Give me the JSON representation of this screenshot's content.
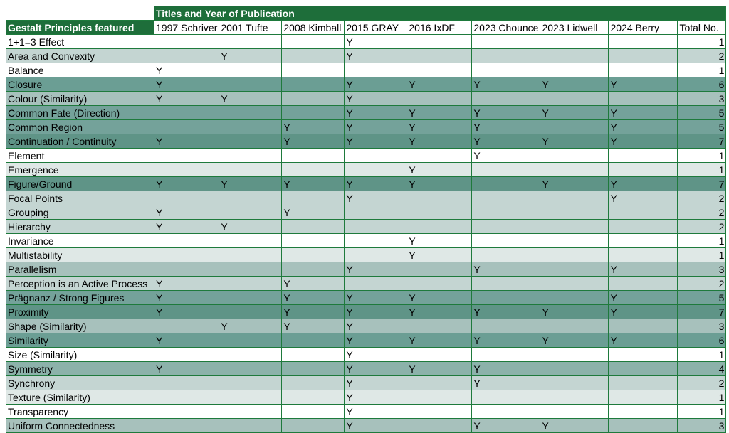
{
  "sheet": {
    "title": "Titles and Year of Publication",
    "row_header_label": "Gestalt Principles featured",
    "columns": [
      "1997 Schriver",
      "2001 Tufte",
      "2008 Kimball",
      "2015 GRAY",
      "2016 IxDF",
      "2023 Chounce",
      "2023 Lidwell",
      "2024 Berry"
    ],
    "total_label": "Total No.",
    "rows": [
      {
        "name": "1+1=3 Effect",
        "marks": [
          "",
          "",
          "",
          "Y",
          "",
          "",
          "",
          ""
        ],
        "total": "1"
      },
      {
        "name": "Area and Convexity",
        "marks": [
          "",
          "Y",
          "",
          "Y",
          "",
          "",
          "",
          ""
        ],
        "total": "2"
      },
      {
        "name": "Balance",
        "marks": [
          "Y",
          "",
          "",
          "",
          "",
          "",
          "",
          ""
        ],
        "total": "1"
      },
      {
        "name": "Closure",
        "marks": [
          "Y",
          "",
          "",
          "Y",
          "Y",
          "Y",
          "Y",
          "Y"
        ],
        "total": "6"
      },
      {
        "name": "Colour (Similarity)",
        "marks": [
          "Y",
          "Y",
          "",
          "Y",
          "",
          "",
          "",
          ""
        ],
        "total": "3"
      },
      {
        "name": "Common Fate (Direction)",
        "marks": [
          "",
          "",
          "",
          "Y",
          "Y",
          "Y",
          "Y",
          "Y"
        ],
        "total": "5"
      },
      {
        "name": "Common Region",
        "marks": [
          "",
          "",
          "Y",
          "Y",
          "Y",
          "Y",
          "",
          "Y"
        ],
        "total": "5"
      },
      {
        "name": "Continuation / Continuity",
        "marks": [
          "Y",
          "",
          "Y",
          "Y",
          "Y",
          "Y",
          "Y",
          "Y"
        ],
        "total": "7"
      },
      {
        "name": "Element",
        "marks": [
          "",
          "",
          "",
          "",
          "",
          "Y",
          "",
          ""
        ],
        "total": "1"
      },
      {
        "name": "Emergence",
        "marks": [
          "",
          "",
          "",
          "",
          "Y",
          "",
          "",
          ""
        ],
        "total": "1"
      },
      {
        "name": "Figure/Ground",
        "marks": [
          "Y",
          "Y",
          "Y",
          "Y",
          "Y",
          "",
          "Y",
          "Y"
        ],
        "total": "7"
      },
      {
        "name": "Focal Points",
        "marks": [
          "",
          "",
          "",
          "Y",
          "",
          "",
          "",
          "Y"
        ],
        "total": "2"
      },
      {
        "name": "Grouping",
        "marks": [
          "Y",
          "",
          "Y",
          "",
          "",
          "",
          "",
          ""
        ],
        "total": "2"
      },
      {
        "name": "Hierarchy",
        "marks": [
          "Y",
          "Y",
          "",
          "",
          "",
          "",
          "",
          ""
        ],
        "total": "2"
      },
      {
        "name": "Invariance",
        "marks": [
          "",
          "",
          "",
          "",
          "Y",
          "",
          "",
          ""
        ],
        "total": "1"
      },
      {
        "name": "Multistability",
        "marks": [
          "",
          "",
          "",
          "",
          "Y",
          "",
          "",
          ""
        ],
        "total": "1"
      },
      {
        "name": "Parallelism",
        "marks": [
          "",
          "",
          "",
          "Y",
          "",
          "Y",
          "",
          "Y"
        ],
        "total": "3"
      },
      {
        "name": "Perception is an Active Process",
        "marks": [
          "Y",
          "",
          "Y",
          "",
          "",
          "",
          "",
          ""
        ],
        "total": "2"
      },
      {
        "name": "Prägnanz / Strong Figures",
        "marks": [
          "Y",
          "",
          "Y",
          "Y",
          "Y",
          "",
          "",
          "Y"
        ],
        "total": "5"
      },
      {
        "name": "Proximity",
        "marks": [
          "Y",
          "",
          "Y",
          "Y",
          "Y",
          "Y",
          "Y",
          "Y"
        ],
        "total": "7"
      },
      {
        "name": "Shape (Similarity)",
        "marks": [
          "",
          "Y",
          "Y",
          "Y",
          "",
          "",
          "",
          ""
        ],
        "total": "3"
      },
      {
        "name": "Similarity",
        "marks": [
          "Y",
          "",
          "",
          "Y",
          "Y",
          "Y",
          "Y",
          "Y"
        ],
        "total": "6"
      },
      {
        "name": "Size (Similarity)",
        "marks": [
          "",
          "",
          "",
          "Y",
          "",
          "",
          "",
          ""
        ],
        "total": "1"
      },
      {
        "name": "Symmetry",
        "marks": [
          "Y",
          "",
          "",
          "Y",
          "Y",
          "Y",
          "",
          ""
        ],
        "total": "4"
      },
      {
        "name": "Synchrony",
        "marks": [
          "",
          "",
          "",
          "Y",
          "",
          "Y",
          "",
          ""
        ],
        "total": "2"
      },
      {
        "name": "Texture (Similarity)",
        "marks": [
          "",
          "",
          "",
          "Y",
          "",
          "",
          "",
          ""
        ],
        "total": "1"
      },
      {
        "name": "Transparency",
        "marks": [
          "",
          "",
          "",
          "Y",
          "",
          "",
          "",
          ""
        ],
        "total": "1"
      },
      {
        "name": "Uniform Connectedness",
        "marks": [
          "",
          "",
          "",
          "Y",
          "",
          "Y",
          "Y",
          ""
        ],
        "total": "3"
      }
    ]
  },
  "colors": {
    "header_green": "#1e6e3a",
    "grid_green": "#1e7a3c"
  }
}
